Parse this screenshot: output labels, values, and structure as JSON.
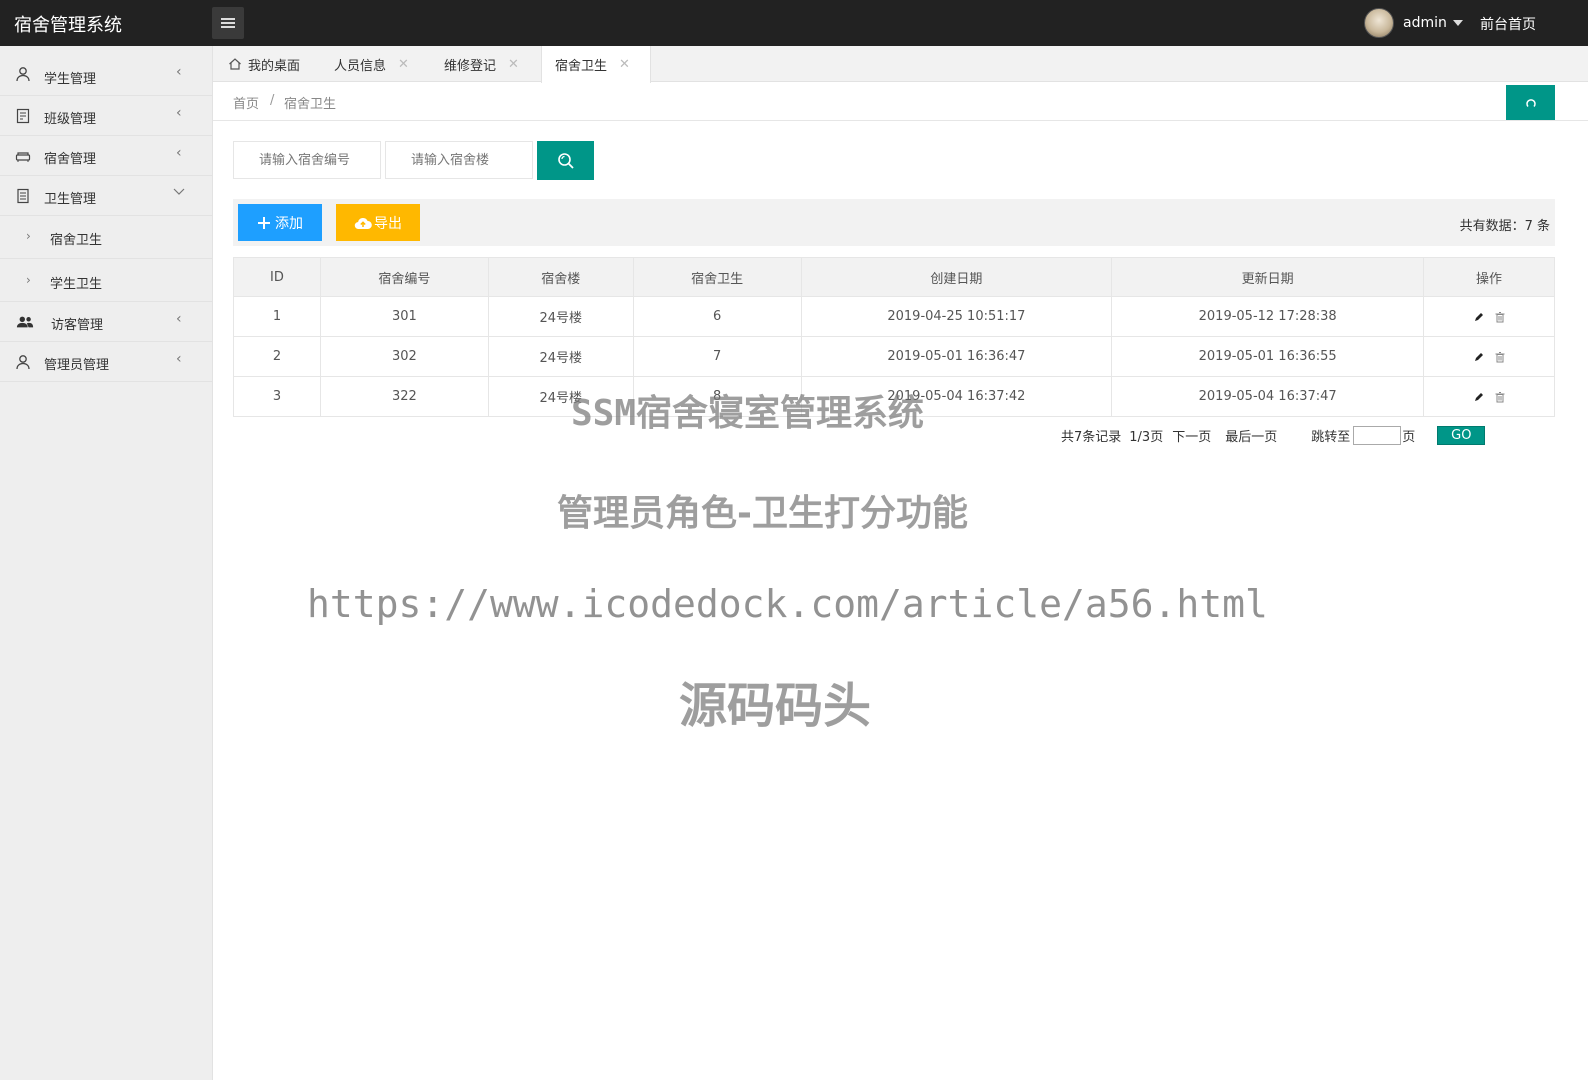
{
  "app": {
    "title": "宿舍管理系统",
    "username": "admin",
    "front_link": "前台首页"
  },
  "sidebar": {
    "items": [
      {
        "label": "学生管理",
        "icon": "user-icon",
        "expanded": false
      },
      {
        "label": "班级管理",
        "icon": "clipboard-icon",
        "expanded": false
      },
      {
        "label": "宿舍管理",
        "icon": "sofa-icon",
        "expanded": false
      },
      {
        "label": "卫生管理",
        "icon": "document-icon",
        "expanded": true,
        "children": [
          {
            "label": "宿舍卫生"
          },
          {
            "label": "学生卫生"
          }
        ]
      },
      {
        "label": "访客管理",
        "icon": "users-icon",
        "expanded": false
      },
      {
        "label": "管理员管理",
        "icon": "admin-icon",
        "expanded": false
      }
    ]
  },
  "tabs": [
    {
      "label": "我的桌面",
      "closable": false,
      "active": false
    },
    {
      "label": "人员信息",
      "closable": true,
      "active": false
    },
    {
      "label": "维修登记",
      "closable": true,
      "active": false
    },
    {
      "label": "宿舍卫生",
      "closable": true,
      "active": true
    }
  ],
  "breadcrumb": {
    "home": "首页",
    "separator": "/",
    "current": "宿舍卫生"
  },
  "search": {
    "dorm_no_placeholder": "请输入宿舍编号",
    "building_placeholder": "请输入宿舍楼"
  },
  "toolbar": {
    "add_label": "添加",
    "export_label": "导出",
    "total_text": "共有数据：7 条"
  },
  "table": {
    "headers": [
      "ID",
      "宿舍编号",
      "宿舍楼",
      "宿舍卫生",
      "创建日期",
      "更新日期",
      "操作"
    ],
    "rows": [
      {
        "id": "1",
        "dorm_no": "301",
        "building": "24号楼",
        "score": "6",
        "created": "2019-04-25 10:51:17",
        "updated": "2019-05-12 17:28:38"
      },
      {
        "id": "2",
        "dorm_no": "302",
        "building": "24号楼",
        "score": "7",
        "created": "2019-05-01 16:36:47",
        "updated": "2019-05-01 16:36:55"
      },
      {
        "id": "3",
        "dorm_no": "322",
        "building": "24号楼",
        "score": "8",
        "created": "2019-05-04 16:37:42",
        "updated": "2019-05-04 16:37:47"
      }
    ]
  },
  "pager": {
    "total": "共7条记录",
    "page": "1/3页",
    "next": "下一页",
    "last": "最后一页",
    "jump_label": "跳转至",
    "page_unit": "页",
    "go": "GO"
  },
  "watermark": {
    "line1": "SSM宿舍寝室管理系统",
    "line2": "管理员角色-卫生打分功能",
    "line3": "https://www.icodedock.com/article/a56.html",
    "line4": "源码码头"
  },
  "colors": {
    "topbar": "#222222",
    "primary": "#009688",
    "add": "#1e9fff",
    "export": "#ffb800"
  }
}
